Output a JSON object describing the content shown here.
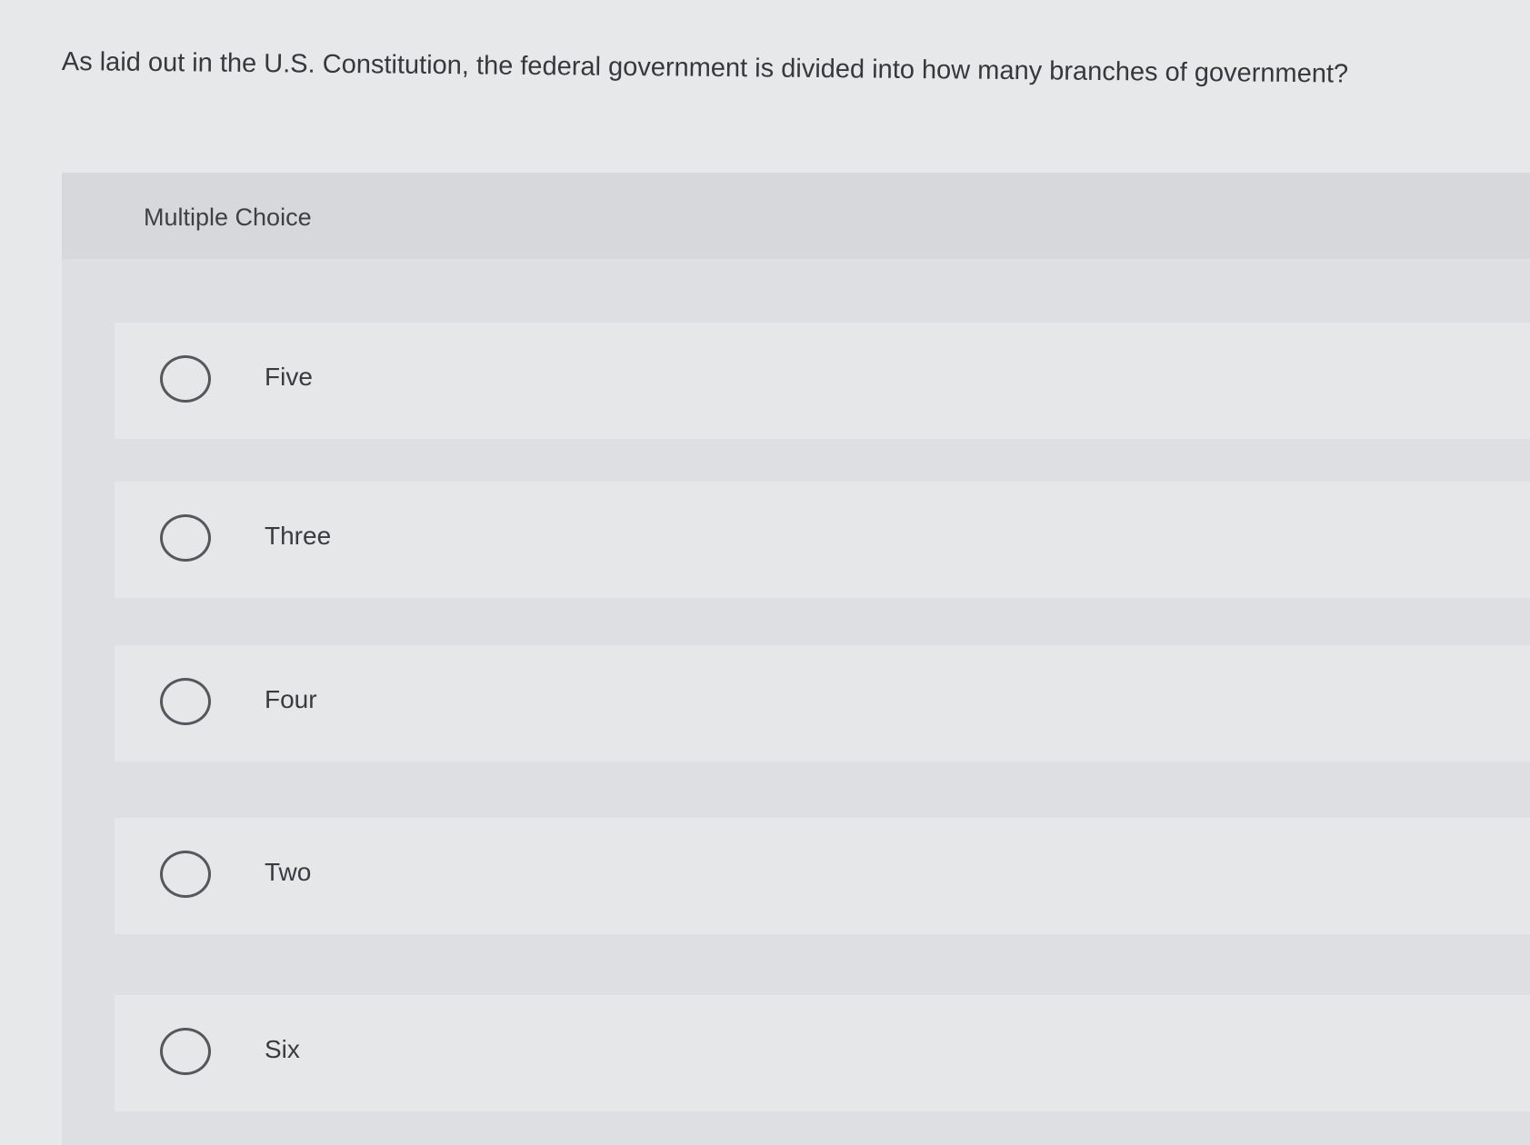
{
  "question": {
    "text": "As laid out in the U.S. Constitution, the federal government is divided into how many branches of government?"
  },
  "multiple_choice": {
    "header_label": "Multiple Choice",
    "options": [
      {
        "label": "Five",
        "selected": false
      },
      {
        "label": "Three",
        "selected": false
      },
      {
        "label": "Four",
        "selected": false
      },
      {
        "label": "Two",
        "selected": false
      },
      {
        "label": "Six",
        "selected": false
      }
    ]
  },
  "icons": {
    "radio": "radio-button-icon"
  },
  "colors": {
    "page_background": "#e7e8ea",
    "panel_background": "#dedfe2",
    "option_background": "#e6e7e9",
    "text": "#37383b",
    "radio_border": "#55575b"
  }
}
